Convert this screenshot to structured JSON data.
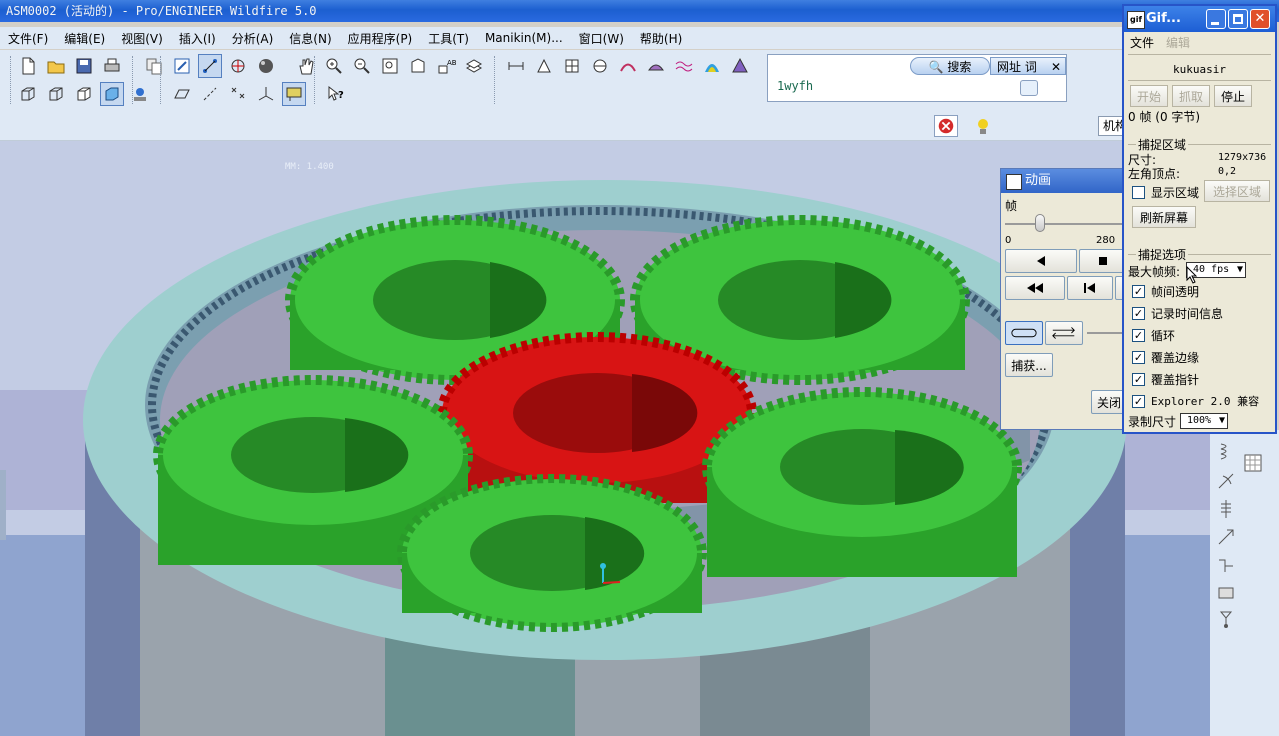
{
  "window": {
    "title": "ASM0002 (活动的) - Pro/ENGINEER Wildfire 5.0"
  },
  "menu": {
    "items": [
      {
        "label": "文件(F)"
      },
      {
        "label": "编辑(E)"
      },
      {
        "label": "视图(V)"
      },
      {
        "label": "插入(I)"
      },
      {
        "label": "分析(A)"
      },
      {
        "label": "信息(N)"
      },
      {
        "label": "应用程序(P)"
      },
      {
        "label": "工具(T)"
      },
      {
        "label": "Manikin(M)..."
      },
      {
        "label": "窗口(W)"
      },
      {
        "label": "帮助(H)"
      }
    ]
  },
  "addressbar": {
    "search_label": "搜索",
    "url_label": "网址 词",
    "value": "1wyfh"
  },
  "strip2": {
    "mechanism_label": "机构"
  },
  "viewport": {
    "status_text": "MM: 1.400"
  },
  "anim_dialog": {
    "title": "动画",
    "frame_label": "帧",
    "slider_min": "0",
    "slider_max": "280",
    "capture_button": "捕获...",
    "close_button": "关闭"
  },
  "gif": {
    "title": "Gif...",
    "menu_file": "文件",
    "menu_edit": "编辑",
    "user": "kukuasir",
    "btn_start": "开始",
    "btn_grab": "抓取",
    "btn_stop": "停止",
    "frame_info": "0 帧 (0 字节)",
    "capture_area_label": "捕捉区域",
    "size_label": "尺寸:",
    "size_value": "1279x736",
    "corner_label": "左角顶点:",
    "corner_value": "0,2",
    "show_area_label": "显示区域",
    "select_area_button": "选择区域",
    "refresh_button": "刷新屏幕",
    "options_label": "捕捉选项",
    "max_fps_label": "最大帧频:",
    "max_fps_value": "40 fps",
    "options": [
      {
        "label": "帧间透明",
        "checked": true
      },
      {
        "label": "记录时间信息",
        "checked": true
      },
      {
        "label": "循环",
        "checked": true
      },
      {
        "label": "覆盖边缘",
        "checked": true
      },
      {
        "label": "覆盖指针",
        "checked": true
      },
      {
        "label": "Explorer 2.0 兼容",
        "checked": true
      }
    ],
    "record_size_label": "录制尺寸",
    "record_size_value": "100%"
  },
  "colors": {
    "gear_green": "#3ec43e",
    "gear_green_dark": "#1f8a1f",
    "gear_red": "#d81414",
    "ring_teal": "#9ccccc",
    "titlebar_blue": "#1c5fd0"
  }
}
